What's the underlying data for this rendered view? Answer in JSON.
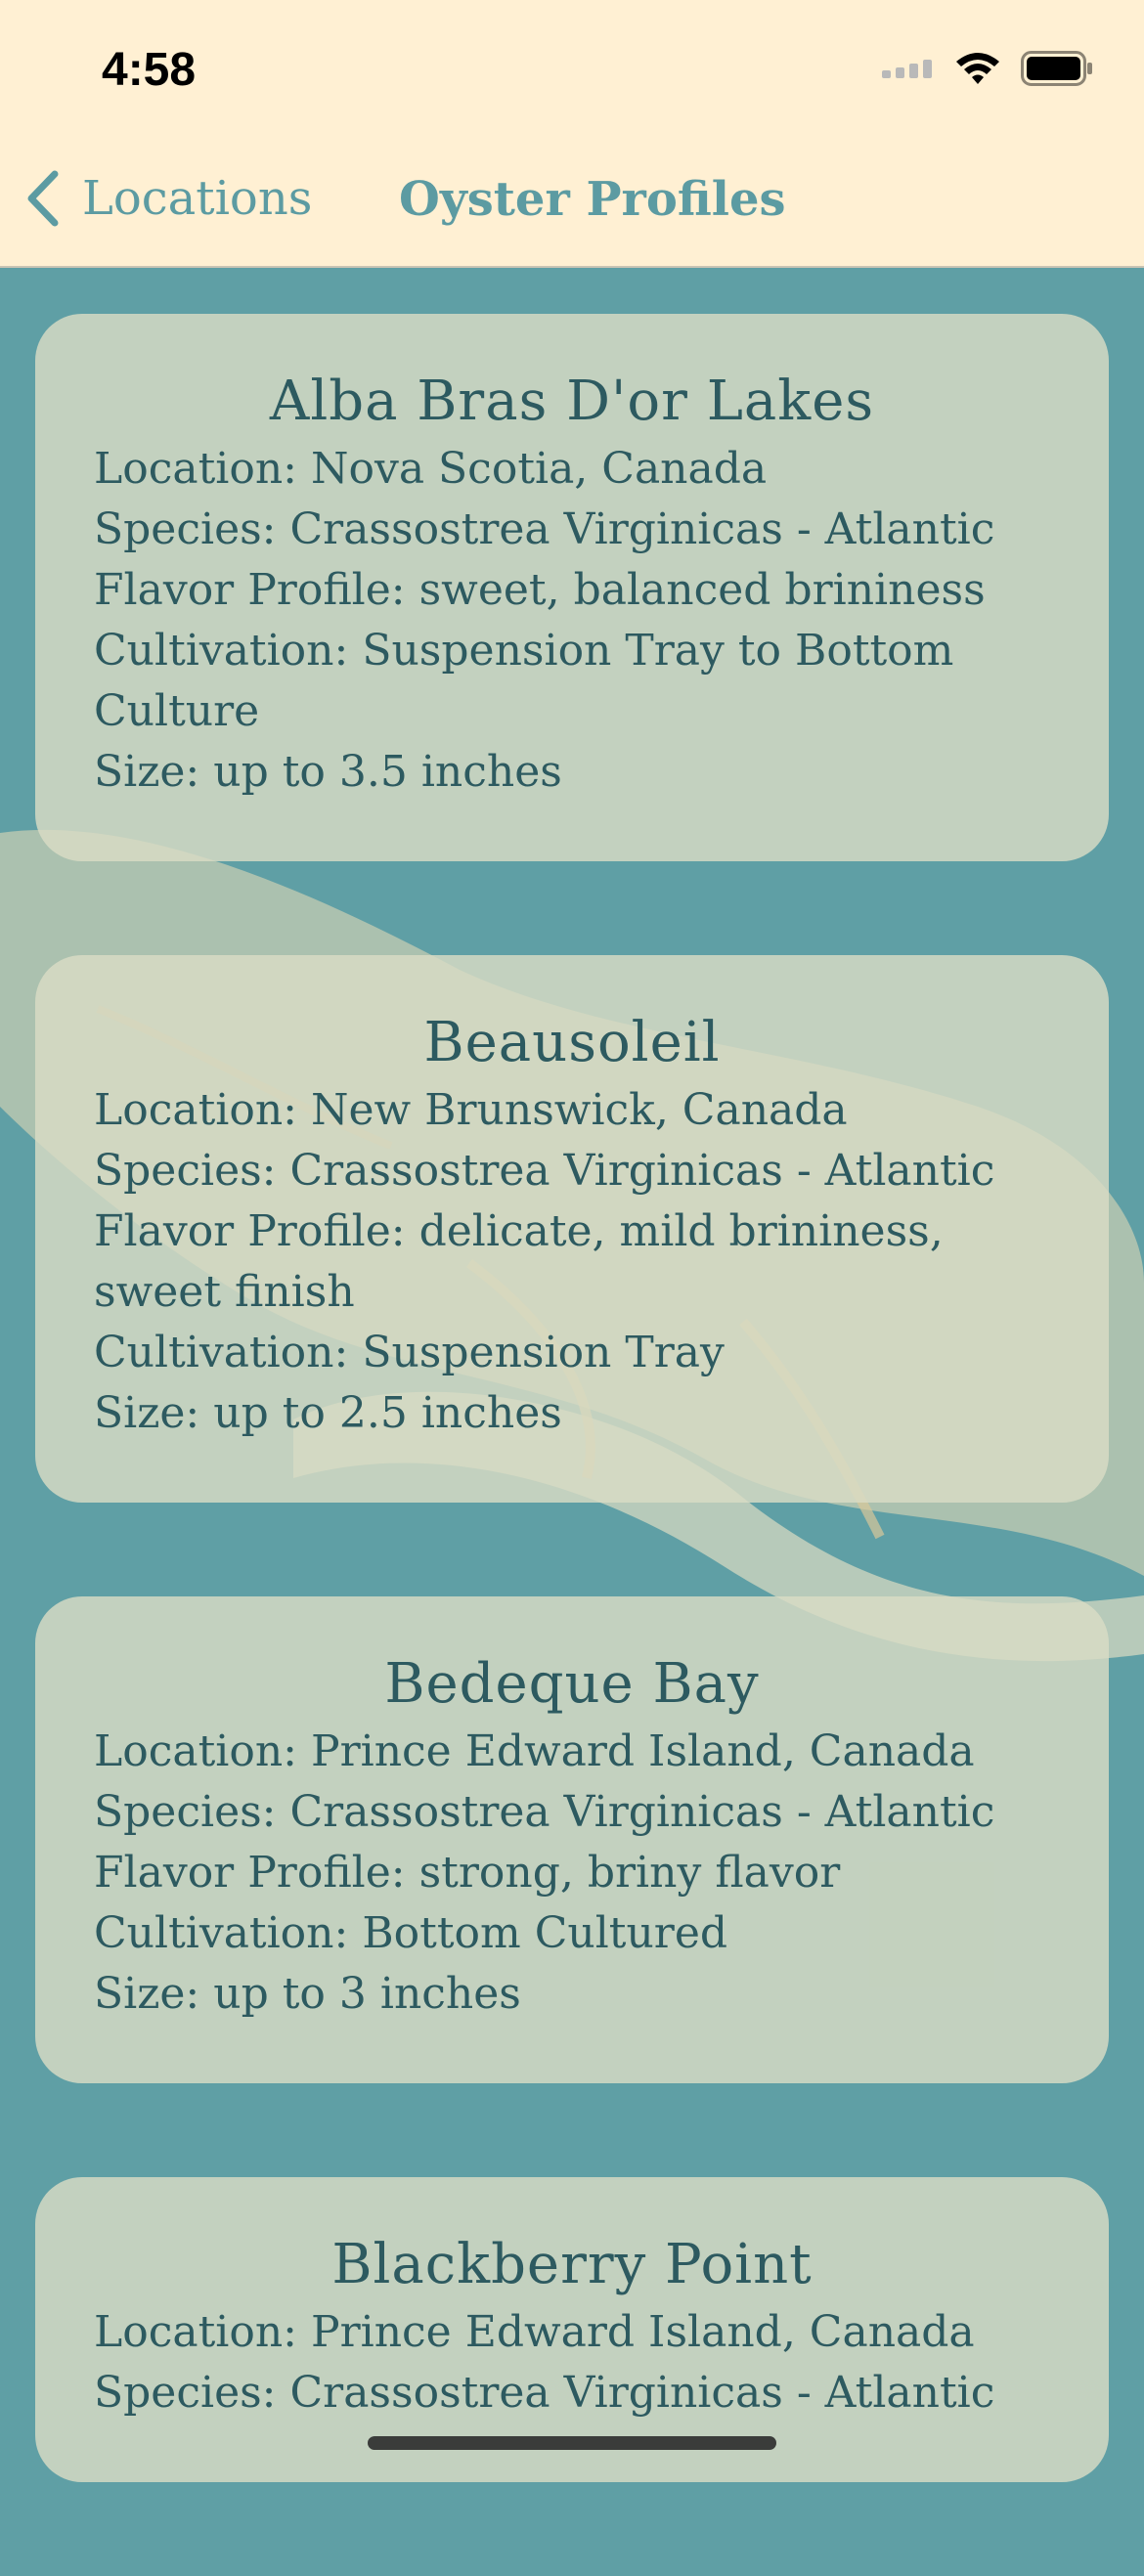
{
  "status_bar": {
    "time": "4:58"
  },
  "nav": {
    "back_label": "Locations",
    "title": "Oyster Profiles"
  },
  "colors": {
    "nav_background": "#fff0d3",
    "accent": "#5c9ba2",
    "page_background": "#5f9fa5",
    "card_text": "#2d5a60"
  },
  "icons": {
    "back": "chevron-left-icon",
    "signal": "cellular-signal-icon",
    "wifi": "wifi-icon",
    "battery": "battery-icon"
  },
  "oysters": [
    {
      "name": "Alba Bras D'or Lakes",
      "location": "Location: Nova Scotia, Canada",
      "species": "Species: Crassostrea Virginicas - Atlantic",
      "flavor": "Flavor Profile: sweet, balanced brininess",
      "cultivation": "Cultivation: Suspension Tray to Bottom Culture",
      "size": "Size: up to 3.5 inches"
    },
    {
      "name": "Beausoleil",
      "location": "Location: New Brunswick, Canada",
      "species": "Species: Crassostrea Virginicas - Atlantic",
      "flavor": "Flavor Profile: delicate, mild brininess, sweet finish",
      "cultivation": "Cultivation: Suspension Tray",
      "size": "Size: up to 2.5 inches"
    },
    {
      "name": "Bedeque Bay",
      "location": "Location: Prince Edward Island, Canada",
      "species": "Species: Crassostrea Virginicas - Atlantic",
      "flavor": "Flavor Profile: strong, briny flavor",
      "cultivation": "Cultivation: Bottom Cultured",
      "size": "Size: up to 3 inches"
    },
    {
      "name": "Blackberry Point",
      "location": "Location: Prince Edward Island, Canada",
      "species": "Species: Crassostrea Virginicas - Atlantic"
    }
  ]
}
